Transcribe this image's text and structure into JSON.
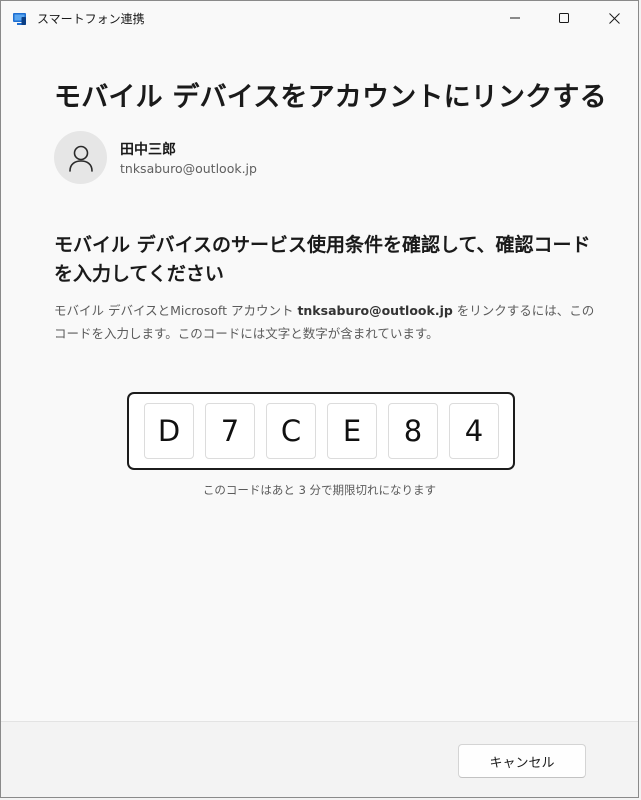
{
  "window": {
    "title": "スマートフォン連携"
  },
  "page": {
    "title": "モバイル デバイスをアカウントにリンクする"
  },
  "account": {
    "name": "田中三郎",
    "email": "tnksaburo@outlook.jp"
  },
  "instructions": {
    "heading": "モバイル デバイスのサービス使用条件を確認して、確認コードを入力してください",
    "description_part1": "モバイル デバイスとMicrosoft アカウント ",
    "description_email": "tnksaburo@outlook.jp",
    "description_part2": " をリンクするには、このコードを入力します。このコードには文字と数字が含まれています。"
  },
  "code": {
    "chars": [
      "D",
      "7",
      "C",
      "E",
      "8",
      "4"
    ],
    "expiry_note": "このコードはあと 3 分で期限切れになります"
  },
  "footer": {
    "cancel_label": "キャンセル"
  },
  "icons": {
    "app": "phone-link-app-icon",
    "minimize": "minimize-icon",
    "maximize": "maximize-icon",
    "close": "close-icon",
    "avatar": "person-icon"
  },
  "colors": {
    "app_icon_blue": "#1f6fd1",
    "code_border": "#1c1c1c",
    "background": "#f9f9f9"
  }
}
